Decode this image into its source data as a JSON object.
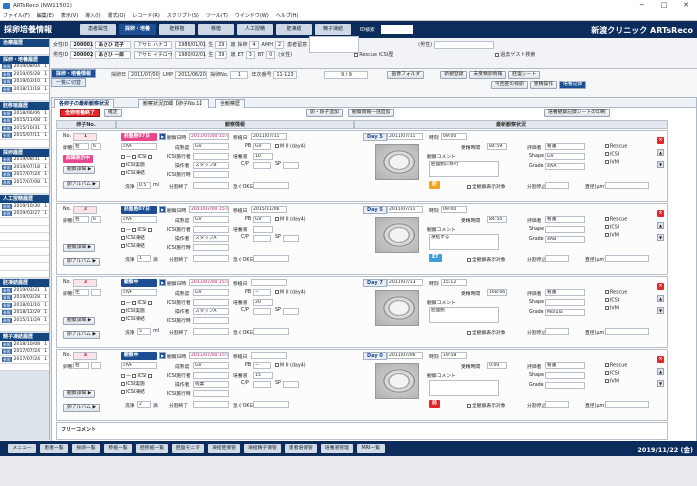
{
  "window": {
    "title": "ARTsReco (NW11501)",
    "minimize": "−",
    "maximize": "□",
    "close": "✕"
  },
  "menu": [
    "ファイル(F)",
    "編集(E)",
    "表示(V)",
    "導入(I)",
    "書式(O)",
    "レコード(R)",
    "スクリプト(S)",
    "ツール(T)",
    "ウインドウ(W)",
    "ヘルプ(H)"
  ],
  "header": {
    "app_title": "採卵培養情報",
    "tabs": [
      "患者属性",
      "採卵・培養",
      "胚移植",
      "移植",
      "人工授精",
      "胚凍結",
      "精子凍結"
    ],
    "active_tab": "採卵・培養",
    "id_label": "ID検索",
    "clinic": "新渡クリニック ARTsReco"
  },
  "sidebar": {
    "sections": [
      {
        "title": "治療履歴",
        "rows": []
      },
      {
        "title": "採卵・培養履歴",
        "rows": [
          [
            "2019/08/04",
            "1"
          ],
          [
            "2019/05/28",
            "1"
          ],
          [
            "2019/03/10",
            "1"
          ],
          [
            "2018/11/18",
            "1"
          ]
        ]
      },
      {
        "title": "胚移植履歴",
        "rows": [
          [
            "2018/06/06",
            "1"
          ],
          [
            "2015/11/08",
            "1"
          ],
          [
            "2015/10/31",
            "1"
          ],
          [
            "2015/07/11",
            "1"
          ]
        ]
      },
      {
        "title": "採卵履歴",
        "rows": [
          [
            "2019/08/31",
            "1"
          ],
          [
            "2019/07/18",
            "1"
          ],
          [
            "2017/07/24",
            "1"
          ],
          [
            "2017/07/08",
            "1"
          ]
        ]
      },
      {
        "title": "人工授精履歴",
        "rows": [
          [
            "2019/10/30",
            "1"
          ],
          [
            "2019/03/27",
            "1"
          ]
        ]
      },
      {
        "title": "胚凍結履歴",
        "rows": [
          [
            "2019/03/21",
            "1"
          ],
          [
            "2019/03/28",
            "1"
          ],
          [
            "2018/01/16",
            "1"
          ],
          [
            "2018/12/29",
            "1"
          ],
          [
            "2015/11/29",
            "1"
          ]
        ]
      },
      {
        "title": "精子凍結履歴",
        "rows": [
          [
            "2018/10/08",
            "1"
          ],
          [
            "2017/07/24",
            "1"
          ],
          [
            "2017/07/24",
            "1"
          ]
        ]
      }
    ],
    "tag": "参照"
  },
  "patient": {
    "wife_label": "女性ID",
    "wife_id": "200001",
    "wife_name": "あさひ 花子",
    "wife_kana": "アサヒ ハナコ",
    "wife_dob": "1986/01/01",
    "wife_age_label": "生",
    "wife_age": "29",
    "wife_age_unit": "歳",
    "wife_gravida_label": "採卵",
    "wife_gravida": "4",
    "amh_label": "AMH",
    "amh": "2",
    "husband_label": "男性ID",
    "husband_id": "200002",
    "husband_name": "あさひ 一郎",
    "husband_kana": "アサヒ イチロウ",
    "husband_dob": "1980/02/01",
    "husband_age": "39",
    "et_label": "ET",
    "et": "3",
    "bt_label": "BT",
    "bt": "0",
    "notes_label": "患者留意",
    "comment_label": "コメント",
    "male_label": "(男性)",
    "rescue_label": "Rescue ICSI歴",
    "ivf_label": "(女性)",
    "past_label": "過去ゲスト検索"
  },
  "subtabs": {
    "main": "採卵・培養情報",
    "list": "一覧に切替",
    "cycle_label": "採卵日",
    "cycle_date": "2011/07/00",
    "lmp_label": "LMP",
    "lmp_date": "2011/06/20",
    "cycle_no_label": "採卵No.",
    "cycle_no": "1",
    "annual_label": "年次番号",
    "annual_no": "11-123",
    "page_label": "9 / 9",
    "status_label": "画像フォルダ",
    "btns": [
      "採卵登録",
      "凍結・移植集計"
    ],
    "right_tabs": [
      "新規登録",
      "未受精卵情報",
      "胚盤シート"
    ],
    "sub_right": [
      "今回胚の採卵",
      "受精操作",
      "培養記録",
      "培養終了報告"
    ]
  },
  "panel": {
    "tabs": [
      "各卵子の最新観察状況",
      "観察状況詳細【卵子No.1】",
      "全観察歴"
    ],
    "all_end": "全卵培養終了",
    "confirm": "確定",
    "add_egg": "卵・卵子追加",
    "batch_enter": "観察情報一括追加",
    "print_label": "培養観察記録シートの印刷",
    "col_egg": "卵子No.",
    "col_obs": "観察情報",
    "col_latest": "最新観察状況",
    "eggs": [
      {
        "no": "1",
        "status": "胚盤胞07日",
        "status_color": "pink",
        "obs_date_label": "観察日時",
        "obs_date": "2011/07/00 15:01",
        "obs2_label": "移植日",
        "obs2": "2011/07/11",
        "side": "右",
        "size": "6",
        "quality": "cIVF",
        "maturity_label": "成熟度",
        "maturity": "GV",
        "pb_label": "PB",
        "pb": "GV",
        "pb_note": "M II (day4)",
        "ops": [
          "ICSI実施",
          "ICSI凍結"
        ],
        "icsi_label": "ICSI施行者",
        "staff_label": "操作者",
        "staff": "スタッフB",
        "culture_label": "培養液",
        "culture": "10",
        "cp_label": "C/P",
        "sp_label": "SP",
        "wash_label": "洗浄",
        "wash": "0.5",
        "wash_unit": "ml",
        "note_label": "急ぐOK日",
        "day": "5",
        "day_date": "2011/07/11",
        "time_label": "時刻",
        "time": "09:00",
        "elapsed_label": "受精時間",
        "elapsed": "84:59",
        "cmt_label": "観察コメント",
        "comment": "胚盤胞に移行",
        "grade_label": "評価者",
        "grader": "看護",
        "shape_label": "Shape",
        "shape": "GV",
        "grade2_label": "Grade",
        "grade2": "4AA",
        "div_label": "分割停止",
        "disp_label": "全観察表示",
        "score": "胚",
        "score_color": "org",
        "cb": [
          "Rescue",
          "ICSI",
          "IVM"
        ]
      },
      {
        "no": "2",
        "status": "胚盤胞07日",
        "status_color": "dblue",
        "obs_date": "2011/07/00 15:01",
        "obs2": "2015/11/06",
        "side": "右",
        "size": "6",
        "quality": "cIVF",
        "maturity": "GV",
        "pb": "GV",
        "pb_note": "M II (day4)",
        "ops": [
          "ICSI凍結",
          "ICSI凍結"
        ],
        "staff": "スタッフA",
        "culture": "",
        "wash": "1",
        "wash_unit": "滴",
        "day": "5",
        "day_date": "2011/07/11",
        "time": "09:00",
        "elapsed": "84:50",
        "comment": "凍結する",
        "grader": "看護",
        "shape": "",
        "grade2": "4AB",
        "score": "ET",
        "score_color": "teal",
        "cb": [
          "Rescue",
          "ICSI",
          "IVM"
        ]
      },
      {
        "no": "3",
        "status": "観察中",
        "status_color": "dblue",
        "obs_date": "2011/07/00 15:01",
        "obs2": "",
        "side": "左",
        "size": "",
        "quality": "cIVF",
        "maturity": "GV",
        "pb": "−",
        "pb_note": "M II (day4)",
        "ops": [
          "ICSI実施",
          "ICSI凍結"
        ],
        "staff": "スタッフA",
        "culture": "20",
        "wash": "5",
        "wash_unit": "ml",
        "day": "7",
        "day_date": "2011/07/13",
        "time": "15:12",
        "elapsed": "168:06",
        "comment": "胚盤胞",
        "grader": "看護",
        "shape": "",
        "grade2": "Morula",
        "score": "",
        "score_color": "",
        "cb": [
          "Rescue",
          "ICSI",
          "IVM"
        ]
      },
      {
        "no": "4",
        "status": "観察中",
        "status_color": "dblue",
        "obs_date": "2011/07/00 15:01",
        "obs2": "",
        "side": "右",
        "size": "",
        "quality": "cIVF",
        "maturity": "GV",
        "pb": "−",
        "pb_note": "M II (day4)",
        "ops": [
          "ICSI実施",
          "ICSI凍結"
        ],
        "staff": "残業",
        "culture": "15",
        "wash": "2",
        "wash_unit": "滴",
        "day": "0",
        "day_date": "2011/07/06",
        "time": "19:58",
        "elapsed": "0:00",
        "comment": "",
        "grader": "看護",
        "shape": "",
        "grade2": "",
        "score": "前",
        "score_color": "red",
        "cb": [
          "Rescue",
          "ICSI",
          "IVM"
        ]
      }
    ],
    "free_comment_label": "フリーコメント"
  },
  "taskbar": {
    "buttons": [
      "メニュー",
      "患者一覧",
      "採卵一覧",
      "移植一覧",
      "胚移植一覧",
      "胚盤モニタ",
      "凍結胚保管",
      "凍結精子保管",
      "患者培保管",
      "培養液管理",
      "MRI一覧"
    ],
    "date": "2019/11/22 (金)"
  }
}
